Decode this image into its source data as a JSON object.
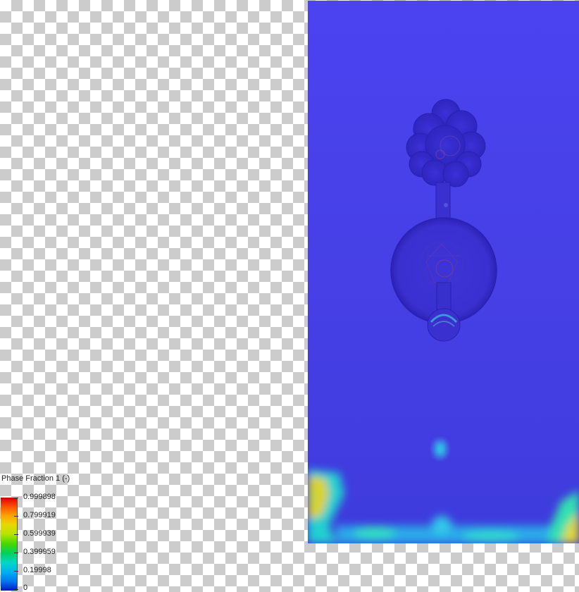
{
  "legend": {
    "title": "Phase Fraction 1 (-)",
    "labels": [
      "0.999898",
      "0.799919",
      "0.599939",
      "0.399959",
      "0.19998",
      "0"
    ]
  },
  "colors": {
    "fluid_background": "#4640e6",
    "high_fraction": "#d40000",
    "low_fraction": "#0018c8"
  }
}
